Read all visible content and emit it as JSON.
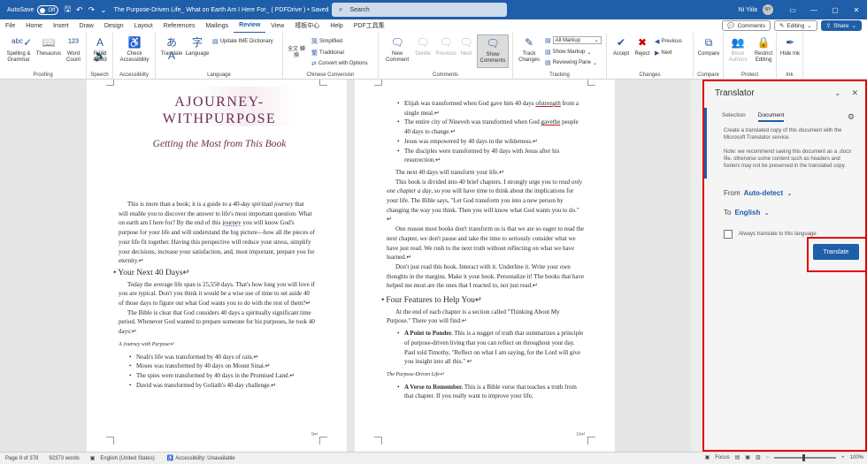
{
  "titlebar": {
    "autosave": "AutoSave",
    "toggle_state": "Off",
    "doc_title": "The Purpose-Driven Life_ What on Earth Am I Here For_ ( PDFDrive ) • Saved",
    "search_placeholder": "Search",
    "user": "Ni Yiila",
    "avatar_initials": "NY"
  },
  "menu": {
    "items": [
      "File",
      "Home",
      "Insert",
      "Draw",
      "Design",
      "Layout",
      "References",
      "Mailings",
      "Review",
      "View",
      "樣板中心",
      "Help",
      "PDF工具集"
    ],
    "active": "Review",
    "comments": "Comments",
    "editing": "Editing",
    "share": "Share"
  },
  "ribbon": {
    "proofing": {
      "label": "Proofing",
      "spelling": "Spelling & Grammar",
      "thesaurus": "Thesaurus",
      "wordcount": "Word Count"
    },
    "speech": {
      "label": "Speech",
      "readaloud": "Read Aloud"
    },
    "accessibility": {
      "label": "Accessibility",
      "check": "Check Accessibility"
    },
    "language": {
      "label": "Language",
      "translate": "Translate",
      "language": "Language",
      "update_ime": "Update IME Dictionary"
    },
    "chinese": {
      "label": "Chinese Conversion",
      "simplified": "Simplified",
      "traditional": "Traditional",
      "convert": "Convert with Options",
      "han": "全文 轉換"
    },
    "comments": {
      "label": "Comments",
      "new": "New Comment",
      "delete": "Delete",
      "previous": "Previous",
      "next": "Next",
      "show": "Show Comments"
    },
    "tracking": {
      "label": "Tracking",
      "track": "Track Changes",
      "markup": "All Markup",
      "showmarkup": "Show Markup",
      "reviewing": "Reviewing Pane"
    },
    "changes": {
      "label": "Changes",
      "accept": "Accept",
      "reject": "Reject",
      "previous": "Previous",
      "next": "Next"
    },
    "compare": {
      "label": "Compare",
      "compare": "Compare"
    },
    "protect": {
      "label": "Protect",
      "block": "Block Authors",
      "restrict": "Restrict Editing"
    },
    "ink": {
      "label": "Ink",
      "hide": "Hide Ink"
    }
  },
  "page_left": {
    "title_line1": "AJOURNEY-",
    "title_line2": "WITHPURPOSE",
    "subtitle": "Getting the Most from This Book",
    "intro": [
      "This is more than a book; it is a guide to a ",
      "40-day spiritual journey",
      " that will enable you to discover the answer to life's most important question: What on earth am I here for? By the end of this ",
      "journey",
      " you will know God's purpose for your life and will understand the big picture—how all the pieces of your life fit together. Having this perspective will reduce your stress, simplify your decisions, increase your satisfaction, and, most important, prepare you for eternity.↵"
    ],
    "heading1": "Your Next 40 Days↵",
    "para2": "Today the average life span is 25,550 days. That's how long you will love if you are typical. Don't you think it would be a wise use of time to set aside 40 of those days to figure out what God wants you to do with the rest of them?↵",
    "para3": "The Bible is clear that God considers 40 days a spiritually significant time period. Whenever God wanted to prepare someone for his purposes, he took 40 days:↵",
    "caption": "A Journey with Purpose↵",
    "bullets": [
      "Noah's life was transformed by 40 days of rain.↵",
      "Moses was transformed by 40 days on Mount Sinai.↵",
      "The spies were transformed by 40 days in the Promised Land.↵",
      "David was transformed by Goliath's 40-day challenge.↵"
    ],
    "page_number": "9↵"
  },
  "page_right": {
    "bullets": [
      [
        "Elijah was transformed when God gave him 40 days ",
        "ofstrength",
        " from a single meal.↵"
      ],
      [
        "The entire city of Nineveh was transformed when God ",
        "gavethe",
        " people 40 days to change.↵"
      ],
      [
        "Jesus was empowered by 40 days in the wilderness.↵",
        "",
        ""
      ],
      [
        "The disciples were transformed by 40 days with Jesus after his resurrection.↵",
        "",
        ""
      ]
    ],
    "para1": "The next 40 days will transform your life.↵",
    "para2a": "This book is divided into 40 brief chapters. I strongly urge you to ",
    "para2b": "read only one chapter a day",
    "para2c": ", so you will have time to think about the implications for your life. The Bible says, \"Let God transform you into a new person by changing the way you think. Then you will know what God wants you to do.\" ↵",
    "para3": "One reason most books don't transform us is that we are so eager to read the next chapter, we don't pause and take the time to seriously consider what we have just read. We rush to the next truth without reflecting on what we have learned.↵",
    "para4": "Don't just read this book. Interact with it. Underline it. Write your own thoughts in the margins. Make it your book. Personalize it! The books that have helped me most are the ones that I reacted to, not just read.↵",
    "heading": "Four Features to Help You↵",
    "para5": "At the end of each chapter is a section called \"Thinking About My Purpose.\" There you will find:↵",
    "feat1_title": "A Point to Ponder.",
    "feat1": " This is a nugget of truth that summarizes a principle of purpose-driven living that you can reflect on throughout your day. Paul told Timothy, \"Reflect on what I am saying, for the Lord will give you insight into all this.\" ↵",
    "caption": "The Purpose-Driven Life↵",
    "feat2_title": "A Verse to Remember.",
    "feat2": " This is a Bible verse that teaches a truth from that chapter. If you really want to improve your life,",
    "page_number": "10↵"
  },
  "translator": {
    "title": "Translator",
    "tab_selection": "Selection",
    "tab_document": "Document",
    "desc": "Create a translated copy of this document with the Microsoft Translator service.",
    "note": "Note: we recommend saving this document as a .docx file, otherwise some content such as headers and footers may not be preserved in the translated copy.",
    "from_label": "From",
    "from_value": "Auto-detect",
    "to_label": "To",
    "to_value": "English",
    "always": "Always translate to this language",
    "button": "Translate"
  },
  "status": {
    "page": "Page 9 of 378",
    "words": "92373 words",
    "lang": "English (United States)",
    "accessibility": "Accessibility: Unavailable",
    "focus": "Focus",
    "zoom": "100%"
  }
}
